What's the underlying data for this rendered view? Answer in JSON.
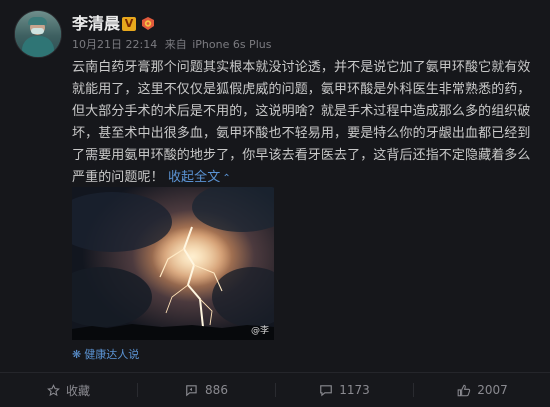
{
  "user": {
    "name": "李清晨",
    "vip_mark": "V"
  },
  "post": {
    "date": "10月21日 22:14",
    "source_prefix": "来自",
    "source": "iPhone 6s Plus",
    "text": "云南白药牙膏那个问题其实根本就没讨论透，并不是说它加了氨甲环酸它就有效就能用了，这里不仅仅是狐假虎威的问题，氨甲环酸是外科医生非常熟悉的药，但大部分手术的术后是不用的，这说明啥？就是手术过程中造成那么多的组织破坏，甚至术中出很多血，氨甲环酸也不轻易用，要是特么你的牙龈出血都已经到了需要用氨甲环酸的地步了，你早该去看牙医去了，这背后还指不定隐藏着多么严重的问题呢！",
    "collapse_label": "收起全文",
    "image_watermark": "@李",
    "topic": "健康达人说"
  },
  "actions": {
    "favorite_label": "收藏",
    "repost_count": "886",
    "comment_count": "1173",
    "like_count": "2007"
  },
  "colors": {
    "background": "#16171b",
    "text": "#c9c9c9",
    "link": "#5b93d3",
    "meta": "#7b7b80",
    "vip": "#e8a81d"
  },
  "icons": {
    "favorite": "star-icon",
    "repost": "repost-icon",
    "comment": "comment-icon",
    "like": "thumbs-up-icon",
    "topic": "flower-icon"
  }
}
